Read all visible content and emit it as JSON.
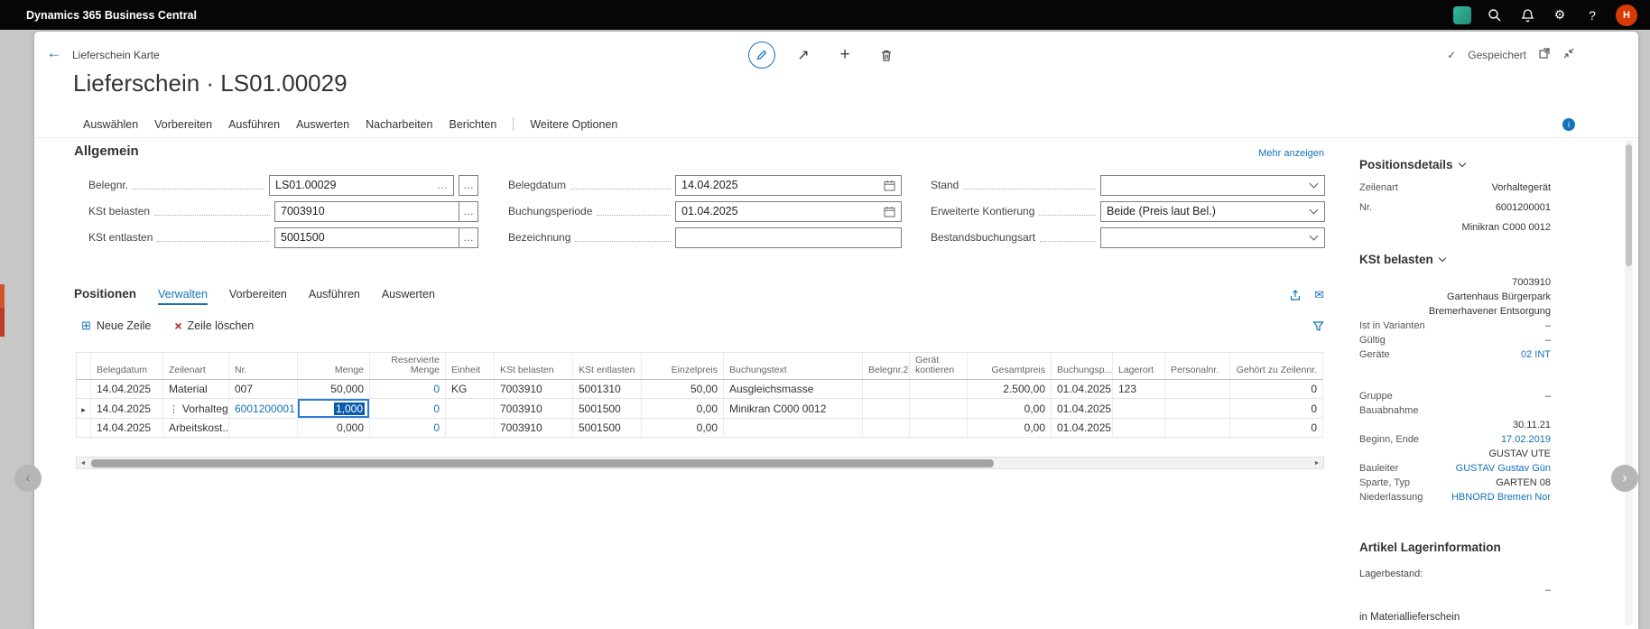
{
  "topbar": {
    "title": "Dynamics 365 Business Central",
    "avatar": "H"
  },
  "icons": {
    "back": "←",
    "share": "↗",
    "new": "+",
    "saved_check": "✓",
    "gear": "⚙",
    "help": "?",
    "mail": "✉",
    "new_line": "⊞",
    "delete_line": "×",
    "nav_prev": "‹",
    "nav_next": "›",
    "scroll_left": "◄",
    "scroll_right": "►",
    "info": "i"
  },
  "header": {
    "breadcrumb": "Lieferschein Karte",
    "title": "Lieferschein · LS01.00029",
    "saved": "Gespeichert"
  },
  "ribbon": {
    "items": [
      "Auswählen",
      "Vorbereiten",
      "Ausführen",
      "Auswerten",
      "Nacharbeiten",
      "Berichten"
    ],
    "more": "Weitere Optionen"
  },
  "general": {
    "title": "Allgemein",
    "more_link": "Mehr anzeigen",
    "col1": [
      {
        "label": "Belegnr.",
        "value": "LS01.00029",
        "ellipsis": true,
        "assist": "detached"
      },
      {
        "label": "KSt belasten",
        "value": "7003910",
        "assist": "attached"
      },
      {
        "label": "KSt entlasten",
        "value": "5001500",
        "assist": "attached"
      }
    ],
    "col2": [
      {
        "label": "Belegdatum",
        "value": "14.04.2025",
        "type": "date"
      },
      {
        "label": "Buchungsperiode",
        "value": "01.04.2025",
        "type": "date"
      },
      {
        "label": "Bezeichnung",
        "value": "",
        "type": "text"
      }
    ],
    "col3": [
      {
        "label": "Stand",
        "value": "",
        "type": "select"
      },
      {
        "label": "Erweiterte Kontierung",
        "value": "Beide (Preis laut Bel.)",
        "type": "select"
      },
      {
        "label": "Bestandsbuchungsart",
        "value": "",
        "type": "select"
      }
    ]
  },
  "positions": {
    "title": "Positionen",
    "tabs": [
      "Verwalten",
      "Vorbereiten",
      "Ausführen",
      "Auswerten"
    ],
    "active_tab": "Verwalten",
    "toolbar": {
      "new_line": "Neue Zeile",
      "delete_line": "Zeile löschen"
    },
    "table": {
      "columns": [
        "Belegdatum",
        "Zeilenart",
        "Nr.",
        "Menge",
        "Reservierte Menge",
        "Einheit",
        "KSt belasten",
        "KSt entlasten",
        "Einzelpreis",
        "Buchungstext",
        "Belegnr.2",
        "Gerät kontieren",
        "Gesamtpreis",
        "Buchungsp...",
        "Lagerort",
        "Personalnr.",
        "Gehört zu Zeilennr."
      ],
      "rows": [
        [
          "14.04.2025",
          "Material",
          "007",
          "50,000",
          "0",
          "KG",
          "7003910",
          "5001310",
          "50,00",
          "Ausgleichsmasse",
          "",
          "",
          "2.500,00",
          "01.04.2025",
          "123",
          "",
          "0"
        ],
        [
          "14.04.2025",
          "Vorhaltege...",
          "6001200001",
          "1,000",
          "0",
          "",
          "7003910",
          "5001500",
          "0,00",
          "Minikran C000 0012",
          "",
          "",
          "0,00",
          "01.04.2025",
          "",
          "",
          "0"
        ],
        [
          "14.04.2025",
          "Arbeitskost...",
          "",
          "0,000",
          "0",
          "",
          "7003910",
          "5001500",
          "0,00",
          "",
          "",
          "",
          "0,00",
          "01.04.2025",
          "",
          "",
          "0"
        ]
      ],
      "selected_row": 1,
      "editing_cell": {
        "row": 1,
        "col": 3
      },
      "link_cells": [
        [
          1,
          2
        ]
      ],
      "link_columns": [
        4
      ]
    }
  },
  "factbox": {
    "sections": [
      {
        "title": "Positionsdetails",
        "rows": [
          {
            "label": "Zeilenart",
            "value": "Vorhaltegerät"
          },
          {
            "label": "Nr.",
            "value": "6001200001"
          },
          {
            "label": "",
            "value": "Minikran C000 0012"
          }
        ]
      },
      {
        "title": "KSt belasten",
        "rows": [
          {
            "label": "",
            "value": "7003910"
          },
          {
            "label": "",
            "value": "Gartenhaus Bürgerpark"
          },
          {
            "label": "",
            "value": "Bremerhavener Entsorgung"
          },
          {
            "label": "Ist in Varianten",
            "value": "–"
          },
          {
            "label": "Gültig",
            "value": "–"
          },
          {
            "label": "Geräte",
            "value": "02 INT",
            "link": true
          },
          {
            "label": "Gruppe",
            "value": "–",
            "gap": true
          },
          {
            "label": "Bauabnahme",
            "value": ""
          },
          {
            "label": "",
            "value": "30.11.21"
          },
          {
            "label": "Beginn, Ende",
            "value": "17.02.2019",
            "link": true
          },
          {
            "label": "",
            "value": "GUSTAV UTE"
          },
          {
            "label": "Bauleiter",
            "value": "GUSTAV Gustav Gün",
            "link": true
          },
          {
            "label": "Sparte, Typ",
            "value": "GARTEN 08"
          },
          {
            "label": "Niederlassung",
            "value": "HBNORD Bremen Nor",
            "link": true
          }
        ]
      }
    ],
    "artikel": {
      "title": "Artikel Lagerinformation",
      "row_label": "Lagerbestand:",
      "row_value": "–",
      "footer": "in Materiallieferschein"
    }
  }
}
